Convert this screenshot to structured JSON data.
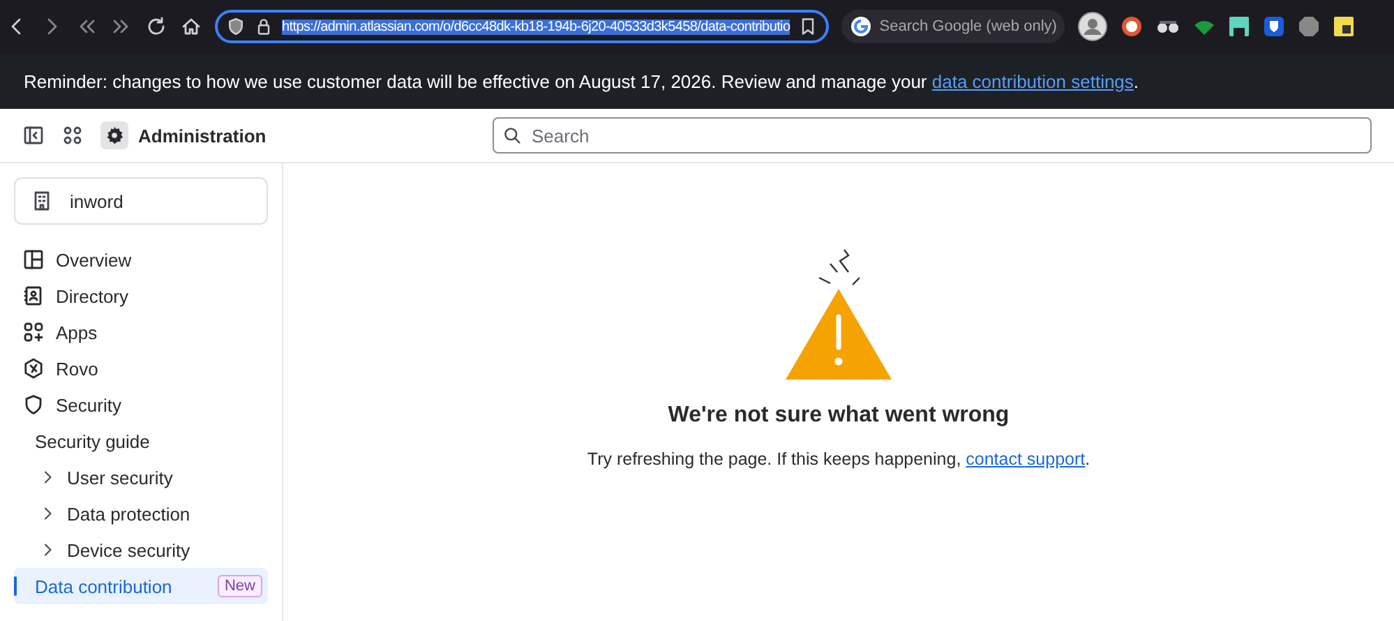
{
  "browser": {
    "url": "https://admin.atlassian.com/o/d6cc48dk-kb18-194b-6j20-40533d3k5458/data-contributio",
    "search_placeholder": "Search Google (web only)"
  },
  "banner": {
    "text": "Reminder: changes to how we use customer data will be effective on August 17, 2026. Review and manage your ",
    "link": "data contribution settings",
    "end": "."
  },
  "header": {
    "title": "Administration",
    "search_placeholder": "Search"
  },
  "org": {
    "name": "inword"
  },
  "sidebar": {
    "items": [
      {
        "label": "Overview",
        "kind": "top",
        "selected": false
      },
      {
        "label": "Directory",
        "kind": "top",
        "selected": false
      },
      {
        "label": "Apps",
        "kind": "top",
        "selected": false
      },
      {
        "label": "Rovo",
        "kind": "top",
        "selected": false
      },
      {
        "label": "Security",
        "kind": "top",
        "selected": false
      },
      {
        "label": "Security guide",
        "kind": "section",
        "selected": false
      },
      {
        "label": "User security",
        "kind": "sub",
        "selected": false
      },
      {
        "label": "Data protection",
        "kind": "sub",
        "selected": false
      },
      {
        "label": "Device security",
        "kind": "sub",
        "selected": false
      },
      {
        "label": "Data contribution",
        "kind": "section",
        "selected": true,
        "badge": "New"
      }
    ]
  },
  "error": {
    "title": "We're not sure what went wrong",
    "text": "Try refreshing the page. If this keeps happening, ",
    "link": "contact support",
    "end": "."
  }
}
